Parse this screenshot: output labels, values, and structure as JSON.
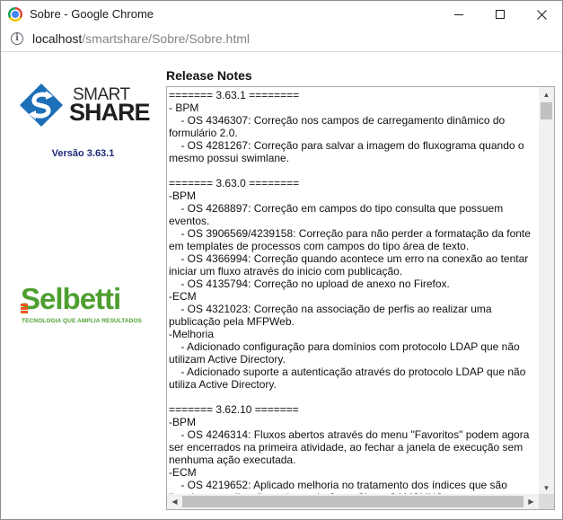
{
  "window": {
    "title": "Sobre - Google Chrome",
    "icon": "chrome-icon"
  },
  "address": {
    "host": "localhost",
    "path": "/smartshare/Sobre/Sobre.html",
    "icon": "info-icon"
  },
  "left": {
    "smartshare_logo": {
      "line1": "SMART",
      "line2": "SHARE"
    },
    "version": "Versão 3.63.1",
    "selbetti_logo": {
      "name": "Selbetti",
      "tagline": "TECNOLOGIA QUE AMPLIA RESULTADOS"
    }
  },
  "notes": {
    "title": "Release Notes",
    "text": "======= 3.63.1 ========\n- BPM\n    - OS 4346307: Correção nos campos de carregamento dinâmico do formulário 2.0.\n    - OS 4281267: Correção para salvar a imagem do fluxograma quando o mesmo possui swimlane.\n\n======= 3.63.0 ========\n-BPM\n    - OS 4268897: Correção em campos do tipo consulta que possuem eventos.\n    - OS 3906569/4239158: Correção para não perder a formatação da fonte em templates de processos com campos do tipo área de texto.\n    - OS 4366994: Correção quando acontece um erro na conexão ao tentar iniciar um fluxo através do inicio com publicação.\n    - OS 4135794: Correção no upload de anexo no Firefox.\n-ECM\n    - OS 4321023: Correção na associação de perfis ao realizar uma publicação pela MFPWeb.\n-Melhoria\n    - Adicionado configuração para domínios com protocolo LDAP que não utilizam Active Directory.\n    - Adicionado suporte a autenticação através do protocolo LDAP que não utiliza Active Directory.\n\n======= 3.62.10 =======\n-BPM\n    - OS 4246314: Fluxos abertos através do menu \"Favoritos\" podem agora ser encerrados na primeira atividade, ao fechar a janela de execução sem nenhuma ação executada.\n-ECM\n    - OS 4219652: Aplicado melhoria no tratamento dos índices que são listados na aplicação embarcada SmartShare SAMSUNG."
  },
  "colors": {
    "version_text": "#1e2a78",
    "selbetti_green": "#4d9f2f",
    "selbetti_orange": "#e85c1e",
    "smartshare_blue": "#1d6fb8"
  }
}
